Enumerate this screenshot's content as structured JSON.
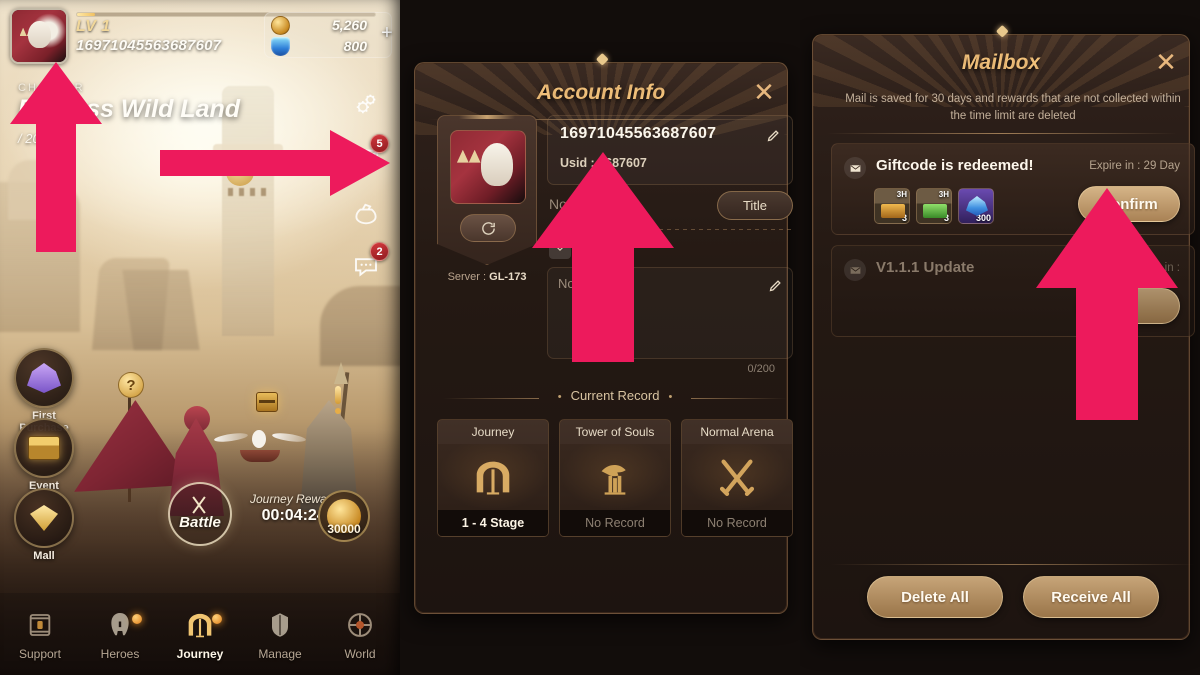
{
  "game": {
    "player": {
      "level_label": "LV 1",
      "nickname": "16971045563687607",
      "xp_percent": 6
    },
    "currency": [
      {
        "icon": "gold-coin-icon",
        "value": "5,260"
      },
      {
        "icon": "blue-gem-icon",
        "value": "800"
      }
    ],
    "add_currency_label": "+",
    "chapter": {
      "kicker": "CHAPTER",
      "title": "Endless Wild Land",
      "progress": "/ 20"
    },
    "rail": [
      {
        "name": "settings-icon",
        "label": "Settings",
        "badge": ""
      },
      {
        "name": "mail-icon",
        "label": "Mail",
        "badge": "5"
      },
      {
        "name": "bag-icon",
        "label": "Bag",
        "badge": ""
      },
      {
        "name": "chat-icon",
        "label": "Chat",
        "badge": "2"
      }
    ],
    "shortcuts": [
      {
        "name": "first-purchase",
        "label": "First\nPurchase",
        "line1": "First",
        "line2": "Purchase"
      },
      {
        "name": "event",
        "label": "Event",
        "line1": "Event",
        "line2": ""
      },
      {
        "name": "mall",
        "label": "Mall",
        "line1": "Mall",
        "line2": ""
      }
    ],
    "help_badge": "?",
    "battle": {
      "label": "Battle"
    },
    "journey_reward": {
      "label": "Journey Reward",
      "timer": "00:04:24",
      "amount": "30000"
    },
    "bottom_nav": [
      {
        "label": "Support",
        "icon": "support-icon",
        "active": false,
        "dot": false
      },
      {
        "label": "Heroes",
        "icon": "helmet-icon",
        "active": false,
        "dot": true
      },
      {
        "label": "Journey",
        "icon": "gate-icon",
        "active": true,
        "dot": true
      },
      {
        "label": "Manage",
        "icon": "manage-icon",
        "active": false,
        "dot": false
      },
      {
        "label": "World",
        "icon": "world-icon",
        "active": false,
        "dot": false
      }
    ]
  },
  "account_info": {
    "title": "Account Info",
    "close_label": "✕",
    "nickname": "16971045563687607",
    "usid_label": "Usid : 3687607",
    "no_titles": "No titles",
    "title_button": "Title",
    "greeting_placeholder": "No greetings",
    "greeting_counter": "0/200",
    "server": "Server : ",
    "server_value": "GL-173",
    "section_label": "Current Record",
    "records": [
      {
        "name": "Journey",
        "icon": "gate-icon",
        "value": "1 - 4 Stage",
        "has_record": true
      },
      {
        "name": "Tower of Souls",
        "icon": "tower-icon",
        "value": "No Record",
        "has_record": false
      },
      {
        "name": "Normal Arena",
        "icon": "swords-icon",
        "value": "No Record",
        "has_record": false
      }
    ]
  },
  "mailbox": {
    "title": "Mailbox",
    "close_label": "✕",
    "description": "Mail is saved for 30 days and rewards that are not collected within the time limit are deleted",
    "mails": [
      {
        "subject": "Giftcode is redeemed!",
        "expire": "Expire in : 29 Day",
        "button": "Confirm",
        "read": false,
        "rewards": [
          {
            "icon": "orange-chest-icon",
            "time": "3H",
            "qty": "3"
          },
          {
            "icon": "green-chest-icon",
            "time": "3H",
            "qty": "3"
          },
          {
            "icon": "gem-icon",
            "time": "",
            "qty": "300"
          }
        ]
      },
      {
        "subject": "V1.1.1 Update",
        "expire": "Expire in :",
        "button": "",
        "read": true,
        "rewards": []
      }
    ],
    "delete_all": "Delete All",
    "receive_all": "Receive All"
  },
  "annotations": {
    "arrow_color": "#ED1A5C",
    "arrows": [
      {
        "name": "arrow-to-avatar",
        "target": "profile-avatar"
      },
      {
        "name": "arrow-to-mail-icon",
        "target": "mail-rail-icon"
      },
      {
        "name": "arrow-to-usid",
        "target": "usid-value"
      },
      {
        "name": "arrow-to-confirm",
        "target": "confirm-button"
      }
    ]
  }
}
